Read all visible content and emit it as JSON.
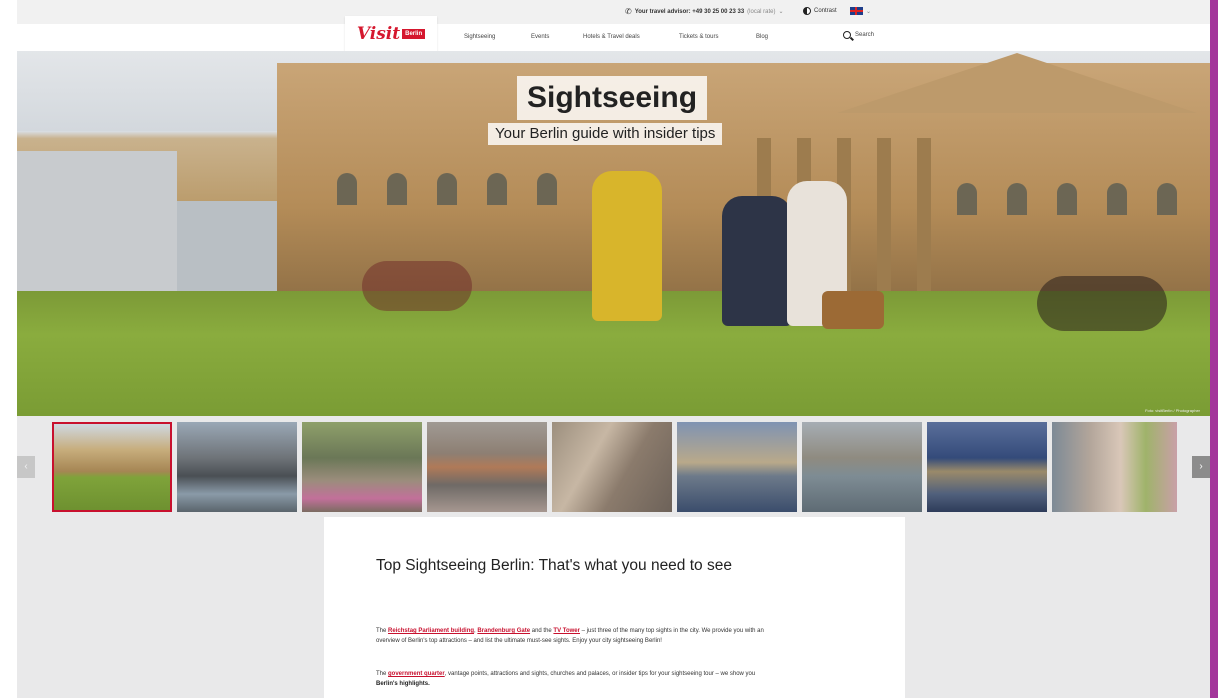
{
  "utility": {
    "phone_label": "Your travel advisor: +49 30 25 00 23 33",
    "phone_note": "(local rate)",
    "contrast_label": "Contrast",
    "lang_chevron": "⌄"
  },
  "brand": {
    "logo_visit": "Visit",
    "logo_city": "Berlin"
  },
  "nav": {
    "items": [
      "Sightseeing",
      "Events",
      "Hotels & Travel deals",
      "Tickets & tours",
      "Blog"
    ],
    "search_label": "Search"
  },
  "hero": {
    "title": "Sightseeing",
    "subtitle": "Your Berlin guide with insider tips",
    "credit": "Foto: visitBerlin / Photographer"
  },
  "gallery": {
    "prev": "‹",
    "next": "›",
    "active_index": 0,
    "thumbs": [
      {
        "icon": "reichstag-photo"
      },
      {
        "icon": "brandenburg-gate-photo"
      },
      {
        "icon": "street-scene-photo"
      },
      {
        "icon": "river-spree-photo"
      },
      {
        "icon": "wall-mural-photo"
      },
      {
        "icon": "tv-tower-skyline-photo"
      },
      {
        "icon": "reichstag-river-photo"
      },
      {
        "icon": "museum-island-photo"
      },
      {
        "icon": "east-side-gallery-photo"
      }
    ]
  },
  "content": {
    "heading": "Top Sightseeing Berlin: That's what you need to see",
    "p1": {
      "link1": "Reichstag Parliament building",
      "sep1": ", ",
      "link2": "Brandenburg Gate",
      "sep2": " and the ",
      "link3": "TV Tower",
      "rest": " – just three of the many top sights in the city. We provide you with an overview of Berlin's top attractions – and list the ultimate must-see sights. Enjoy your city sightseeing Berlin!"
    },
    "p2": {
      "lead": "The ",
      "link": "government quarter",
      "rest": ", vantage points, attractions and sights, churches and palaces, or insider tips for your sightseeing tour – we show you ",
      "bold": "Berlin's highlights."
    }
  },
  "colors": {
    "brand_red": "#c8102e",
    "frame": "#a3359a"
  }
}
